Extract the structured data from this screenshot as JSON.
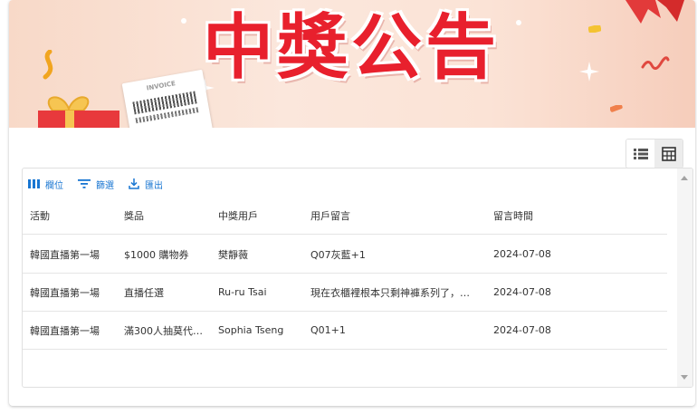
{
  "banner": {
    "title": "中獎公告",
    "invoice_label": "INVOICE"
  },
  "view_toggle": {
    "list_icon": "list-view-icon",
    "table_icon": "table-view-icon",
    "active": "table"
  },
  "grid": {
    "toolbar": {
      "columns_label": "欄位",
      "filter_label": "篩選",
      "export_label": "匯出"
    },
    "columns": [
      "活動",
      "獎品",
      "中獎用戶",
      "用戶留言",
      "留言時間"
    ],
    "rows": [
      [
        "韓國直播第一場",
        "$1000 購物券",
        "樊靜薇",
        "Q07灰藍+1",
        "2024-07-08"
      ],
      [
        "韓國直播第一場",
        "直播任選",
        "Ru-ru Tsai",
        "現在衣櫃裡根本只剩神褲系列了，…",
        "2024-07-08"
      ],
      [
        "韓國直播第一場",
        "滿300人抽莫代…",
        "Sophia Tseng",
        "Q01+1",
        "2024-07-08"
      ]
    ]
  },
  "colors": {
    "accent": "#1976d2",
    "banner_title": "#e8202d"
  }
}
